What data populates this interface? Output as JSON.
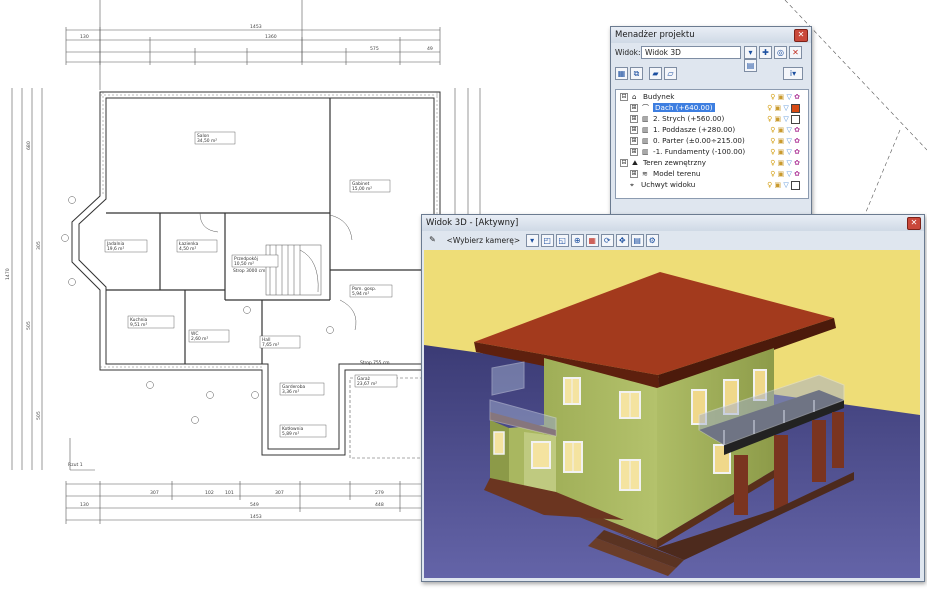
{
  "project_manager": {
    "title": "Menadżer projektu",
    "view_label": "Widok:",
    "view_value": "Widok 3D",
    "tree": [
      {
        "level": 0,
        "label": "Budynek",
        "icon": "building-icon",
        "expander": "⊟"
      },
      {
        "level": 1,
        "label": "Dach (+640.00)",
        "icon": "roof-icon",
        "expander": "⊞",
        "selected": true,
        "color": "#d84a13"
      },
      {
        "level": 1,
        "label": "2. Strych (+560.00)",
        "icon": "floor-icon",
        "expander": "⊞",
        "color": "#ffffff"
      },
      {
        "level": 1,
        "label": "1. Poddasze (+280.00)",
        "icon": "floor-icon",
        "expander": "⊞"
      },
      {
        "level": 1,
        "label": "0. Parter (±0.00÷215.00)",
        "icon": "floor-icon",
        "expander": "⊞"
      },
      {
        "level": 1,
        "label": "-1. Fundamenty (-100.00)",
        "icon": "floor-icon",
        "expander": "⊞"
      },
      {
        "level": 0,
        "label": "Teren zewnętrzny",
        "icon": "terrain-icon",
        "expander": "⊟"
      },
      {
        "level": 1,
        "label": "Model terenu",
        "icon": "terrain-model-icon",
        "expander": "⊞"
      },
      {
        "level": 0,
        "label": "Uchwyt widoku",
        "icon": "view-handle-icon",
        "expander": "",
        "color": "#ffffff"
      }
    ]
  },
  "view3d": {
    "title": "Widok 3D - [Aktywny]",
    "camera_placeholder": "<Wybierz kamerę>"
  },
  "plan": {
    "axis_label": "Rzut 1",
    "dims_top": [
      "1453",
      "1360",
      "130",
      "575",
      "49"
    ],
    "dims_bottom": [
      "307",
      "102",
      "101",
      "307",
      "1453",
      "279",
      "448",
      "549",
      "130"
    ],
    "dims_left": [
      "1470",
      "680",
      "505",
      "305",
      "505"
    ],
    "rooms": [
      {
        "num": "1",
        "name": "Salon",
        "area": "34,50 m²",
        "floor": "Parkiet"
      },
      {
        "num": "8",
        "name": "Gabinet",
        "area": "15,00 m²",
        "floor": "Parkiet"
      },
      {
        "num": "10",
        "name": "Jadalnia",
        "area": "19,6 m²",
        "floor": "Parkiet"
      },
      {
        "num": "9",
        "name": "Łazienka",
        "area": "4,50 m²",
        "floor": "Terakota"
      },
      {
        "num": "7",
        "name": "Przedpokój",
        "area": "10,50 m²",
        "floor": "Terakota"
      },
      {
        "num": "11",
        "name": "Kuchnia",
        "area": "9,51 m²",
        "floor": "Terakota"
      },
      {
        "num": "5",
        "name": "WC",
        "area": "2,60 m²",
        "floor": "Terakota"
      },
      {
        "num": "4",
        "name": "Hall",
        "area": "7,65 m²",
        "floor": "Terakota"
      },
      {
        "num": "3",
        "name": "Garderoba",
        "area": "3,36 m²",
        "floor": "Terakota"
      },
      {
        "num": "2",
        "name": "Pom. gosp.",
        "area": "5,94 m²",
        "floor": "Terakota"
      },
      {
        "num": "6",
        "name": "Kotłownia",
        "area": "5,89 m²",
        "floor": "Terakota"
      },
      {
        "num": "6",
        "name": "Garaż",
        "area": "23,67 m²",
        "floor": "Grès"
      }
    ],
    "notes": [
      "Strop 3000 cm",
      "Strop 755 cm"
    ]
  },
  "colors": {
    "wall_yellow": "#eedd77",
    "floor_blue": "#4a4a86",
    "facade_green": "#a5b460",
    "roof_red": "#7a2814",
    "selection_blue": "#3d7ee0"
  }
}
